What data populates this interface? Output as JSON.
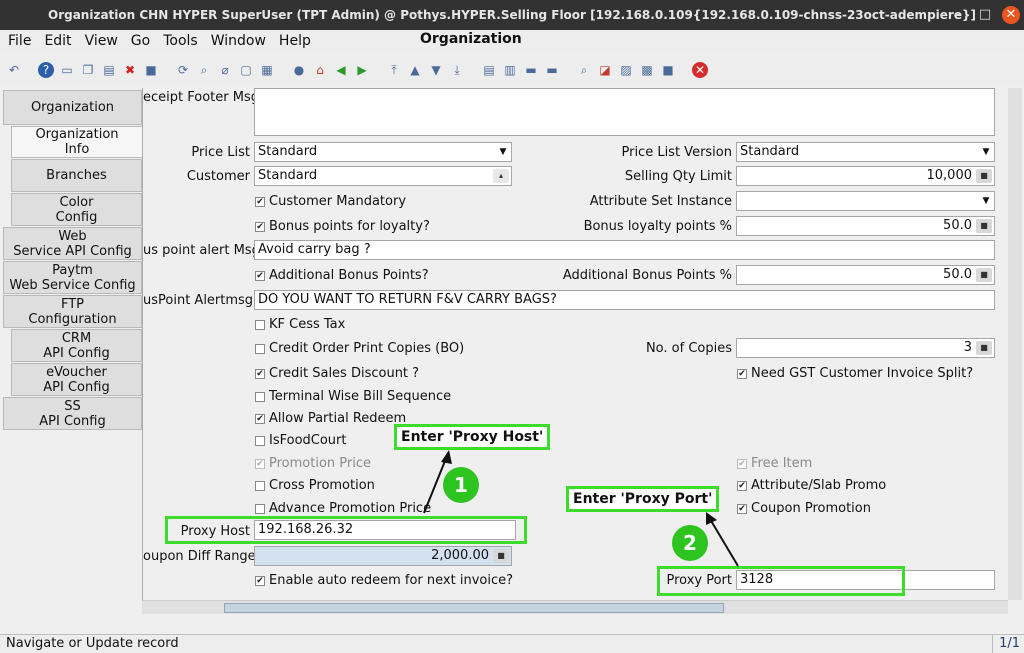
{
  "window": {
    "title": "Organization  CHN  HYPER  SuperUser (TPT Admin) @ Pothys.HYPER.Selling Floor [192.168.0.109{192.168.0.109-chnss-23oct-adempiere}]",
    "min": "–",
    "max": "□",
    "close": "✕"
  },
  "menu": {
    "file": "File",
    "edit": "Edit",
    "view": "View",
    "go": "Go",
    "tools": "Tools",
    "window": "Window",
    "help": "Help"
  },
  "window_name": "Organization",
  "tabs": [
    {
      "label": "Organization"
    },
    {
      "label": "Organization\nInfo"
    },
    {
      "label": "Branches"
    },
    {
      "label": "Color\nConfig"
    },
    {
      "label": "Web\nService API Config"
    },
    {
      "label": "Paytm\nWeb Service Config"
    },
    {
      "label": "FTP\nConfiguration"
    },
    {
      "label": "CRM\nAPI Config"
    },
    {
      "label": "eVoucher\nAPI Config"
    },
    {
      "label": "SS\nAPI Config"
    }
  ],
  "form": {
    "receipt_footer_label": "eceipt Footer Msg",
    "price_list_label": "Price List",
    "price_list_value": "Standard",
    "price_list_version_label": "Price List Version",
    "price_list_version_value": "Standard",
    "customer_label": "Customer",
    "customer_value": "Standard",
    "selling_qty_limit_label": "Selling Qty Limit",
    "selling_qty_limit_value": "10,000",
    "customer_mandatory": "Customer Mandatory",
    "attribute_set_instance_label": "Attribute Set Instance",
    "bonus_points_loyalty": "Bonus points for loyalty?",
    "bonus_loyalty_pct_label": "Bonus loyalty points %",
    "bonus_loyalty_pct_value": "50.0",
    "bonus_alert_msg_label": "us point alert Msg",
    "bonus_alert_msg_value": "Avoid carry bag ?",
    "additional_bonus_points": "Additional Bonus Points?",
    "additional_bonus_pct_label": "Additional Bonus Points %",
    "additional_bonus_pct_value": "50.0",
    "bonus_point_alertmsg_label": "usPoint Alertmsg",
    "bonus_point_alertmsg_value": "DO YOU WANT TO RETURN F&V CARRY BAGS?",
    "kf_cess_tax": "KF Cess Tax",
    "credit_order_print_copies": "Credit Order Print Copies (BO)",
    "no_of_copies_label": "No. of Copies",
    "no_of_copies_value": "3",
    "credit_sales_discount": "Credit Sales Discount ?",
    "need_gst_split": "Need GST Customer Invoice Split?",
    "terminal_wise_bill_sequence": "Terminal Wise Bill Sequence",
    "allow_partial_redeem": "Allow Partial Redeem",
    "is_food_court": "IsFoodCourt",
    "promotion_price": "Promotion Price",
    "free_item": "Free Item",
    "cross_promotion": "Cross Promotion",
    "attribute_slab_promo": "Attribute/Slab Promo",
    "advance_promotion_price": "Advance Promotion Price",
    "coupon_promotion": "Coupon Promotion",
    "proxy_host_label": "Proxy Host",
    "proxy_host_value": "192.168.26.32",
    "coupon_diff_range_label": "oupon Diff Range",
    "coupon_diff_range_value": "2,000.00",
    "enable_auto_redeem": "Enable auto redeem for next invoice?",
    "proxy_port_label": "Proxy Port",
    "proxy_port_value": "3128"
  },
  "annotations": {
    "callout1": "Enter 'Proxy Host'",
    "callout2": "Enter 'Proxy Port'",
    "badge1": "1",
    "badge2": "2"
  },
  "status": {
    "message": "Navigate or Update record",
    "record": "1/1"
  },
  "colors": {
    "highlight": "#3bdc2a",
    "badge": "#2ec420"
  }
}
